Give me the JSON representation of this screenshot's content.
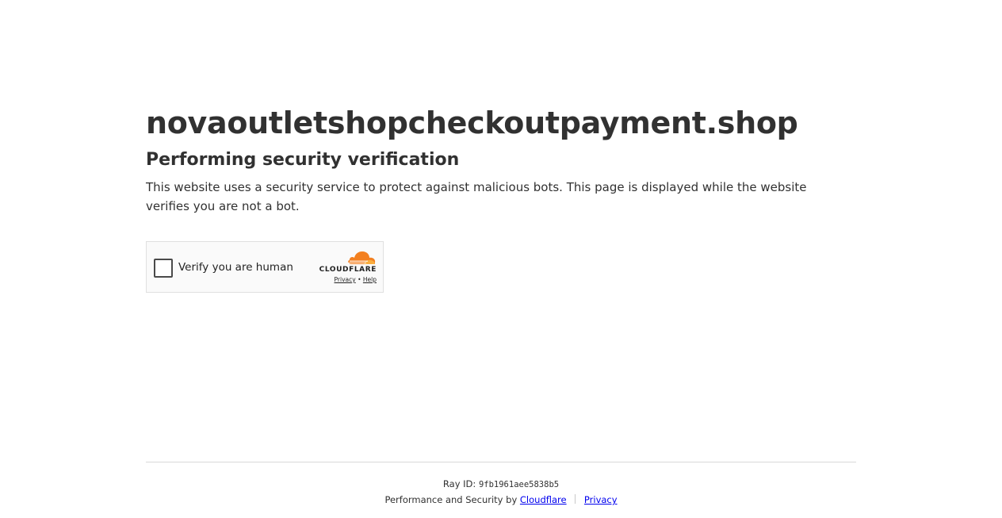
{
  "header": {
    "site_name": "novaoutletshopcheckoutpayment.shop",
    "subtitle": "Performing security verification",
    "description": "This website uses a security service to protect against malicious bots. This page is displayed while the website verifies you are not a bot."
  },
  "challenge": {
    "checkbox_label": "Verify you are human",
    "checked": false,
    "brand_name": "CLOUDFLARE",
    "brand_icon": "cloudflare-cloud-icon",
    "privacy_link": "Privacy",
    "link_separator": "•",
    "help_link": "Help",
    "brand_color": "#f38020"
  },
  "footer": {
    "ray_label": "Ray ID:",
    "ray_id": "9fb1961aee5838b5",
    "perf_text": "Performance and Security by",
    "cloudflare_link": "Cloudflare",
    "privacy_link": "Privacy"
  }
}
